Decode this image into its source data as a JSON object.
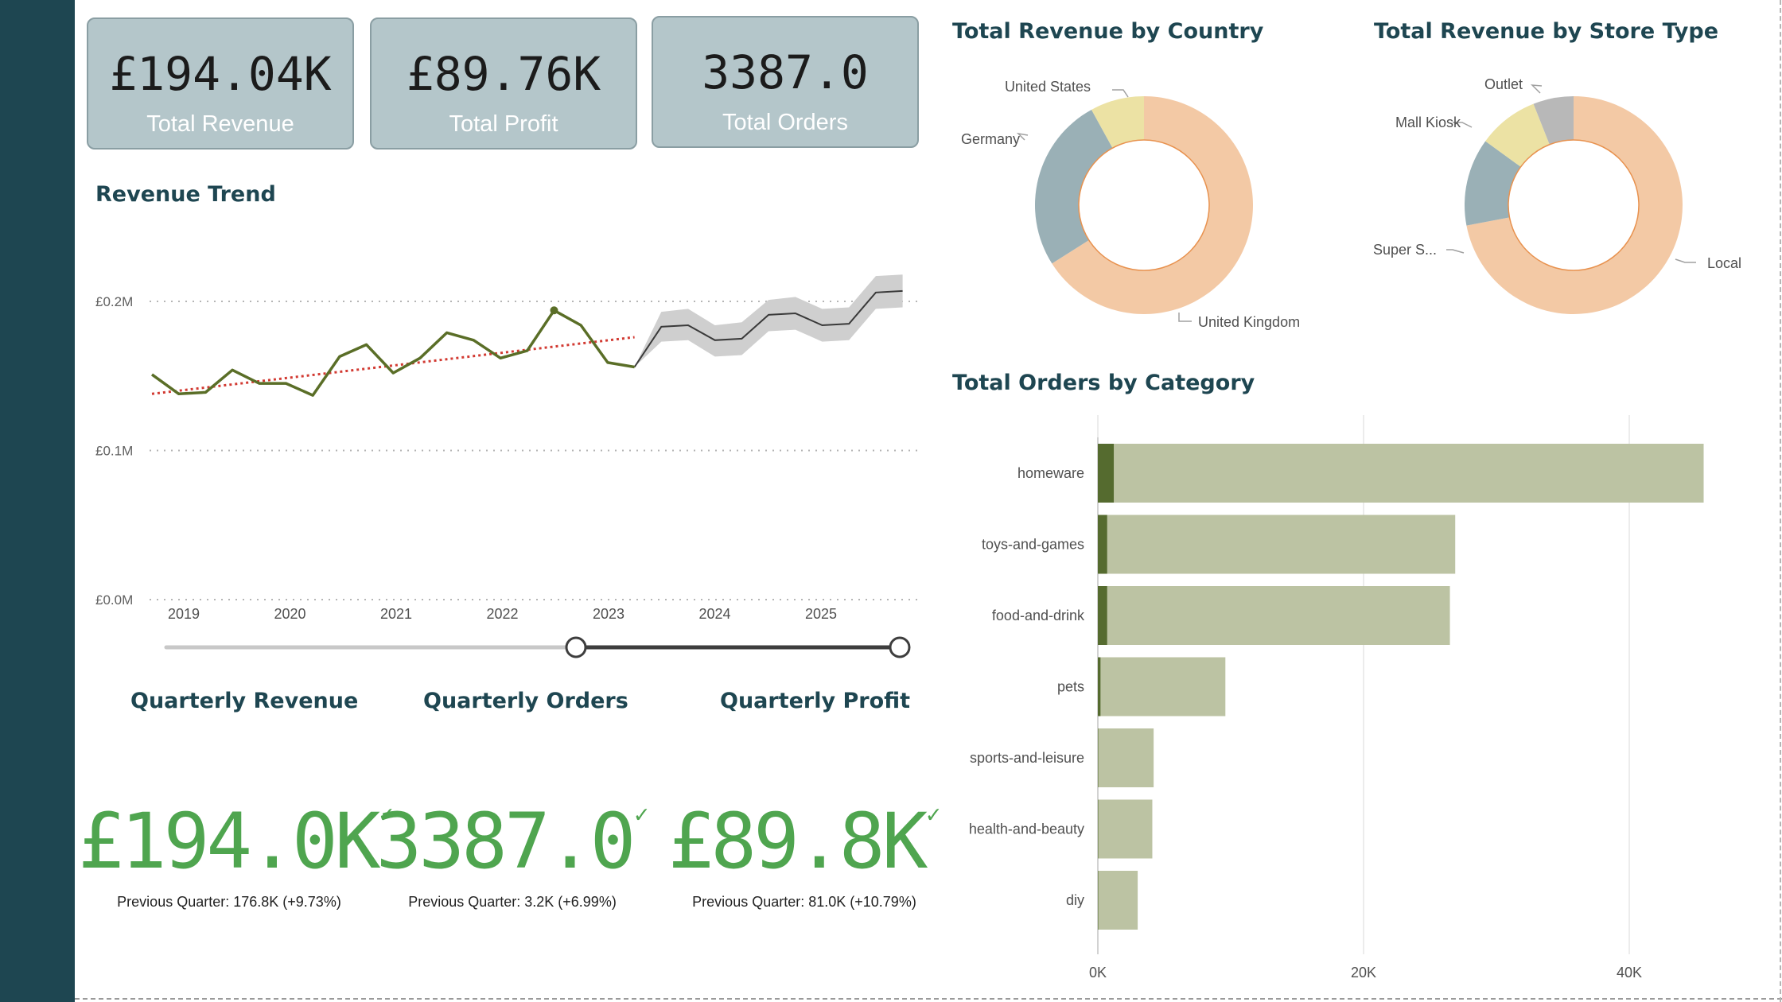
{
  "cards": [
    {
      "value": "£194.04K",
      "label": "Total Revenue"
    },
    {
      "value": "£89.76K",
      "label": "Total Profit"
    },
    {
      "value": "3387.0",
      "label": "Total Orders"
    }
  ],
  "titles": {
    "revenue_trend": "Revenue Trend",
    "quarterly_revenue": "Quarterly Revenue",
    "quarterly_orders": "Quarterly Orders",
    "quarterly_profit": "Quarterly Profit",
    "revenue_by_country": "Total Revenue by Country",
    "revenue_by_store_type": "Total Revenue by Store Type",
    "orders_by_category": "Total Orders by Category"
  },
  "kpis": [
    {
      "value": "£194.0K",
      "check": "✓",
      "previous": "Previous Quarter: 176.8K (+9.73%)"
    },
    {
      "value": "3387.0",
      "check": "✓",
      "previous": "Previous Quarter: 3.2K (+6.99%)"
    },
    {
      "value": "£89.8K",
      "check": "✓",
      "previous": "Previous Quarter: 81.0K (+10.79%)"
    }
  ],
  "colors": {
    "sidebar": "#1e4651",
    "card_bg": "#b4c6ca",
    "trend_line": "#5a6e27",
    "forecast_line": "#3a3a3a",
    "forecast_band": "#cfcfcf",
    "trend_dotted": "#d23a32",
    "kpi_green": "#4fa54f",
    "bar_light": "#bcc3a3",
    "bar_dark": "#556b2f",
    "donut_peach": "#f3c9a5",
    "donut_slate": "#9ab0b6",
    "donut_khaki": "#ece2a4",
    "donut_grey": "#b8b8b8"
  },
  "chart_data": [
    {
      "type": "line",
      "title": "Revenue Trend",
      "y_ticks": [
        "£0.0M",
        "£0.1M",
        "£0.2M"
      ],
      "ylim": [
        0,
        0.2
      ],
      "x_ticks": [
        "2019",
        "2020",
        "2021",
        "2022",
        "2023",
        "2024",
        "2025"
      ],
      "series": [
        {
          "values": [
            0.151,
            0.138,
            0.139,
            0.154,
            0.145,
            0.145,
            0.137,
            0.163,
            0.171,
            0.152,
            0.162,
            0.179,
            0.174,
            0.162,
            0.167,
            0.194,
            0.184,
            0.159,
            0.156
          ]
        }
      ],
      "forecast": {
        "values": [
          0.156,
          0.183,
          0.184,
          0.174,
          0.175,
          0.191,
          0.192,
          0.184,
          0.185,
          0.206,
          0.207
        ],
        "lower": [
          0.156,
          0.173,
          0.174,
          0.163,
          0.164,
          0.18,
          0.181,
          0.173,
          0.174,
          0.195,
          0.196
        ],
        "upper": [
          0.156,
          0.193,
          0.195,
          0.184,
          0.186,
          0.201,
          0.203,
          0.195,
          0.196,
          0.217,
          0.218
        ]
      },
      "trend_line": {
        "start": 0.138,
        "end": 0.176
      },
      "slider": {
        "range": [
          "2023",
          "2025"
        ]
      }
    },
    {
      "type": "pie",
      "title": "Total Revenue by Country",
      "categories": [
        "United Kingdom",
        "Germany",
        "United States"
      ],
      "values": [
        66,
        26,
        8
      ]
    },
    {
      "type": "pie",
      "title": "Total Revenue by Store Type",
      "categories": [
        "Local",
        "Super S...",
        "Mall Kiosk",
        "Outlet"
      ],
      "values": [
        72,
        13,
        9,
        6
      ]
    },
    {
      "type": "bar",
      "title": "Total Orders by Category",
      "categories": [
        "homeware",
        "toys-and-games",
        "food-and-drink",
        "pets",
        "sports-and-leisure",
        "health-and-beauty",
        "diy"
      ],
      "series": [
        {
          "values": [
            45600,
            26900,
            26500,
            9600,
            4200,
            4100,
            3000
          ]
        },
        {
          "values": [
            1200,
            700,
            700,
            200,
            0,
            0,
            0
          ]
        }
      ],
      "x_ticks": [
        "0K",
        "20K",
        "40K"
      ],
      "xlim": [
        0,
        40000
      ]
    }
  ]
}
